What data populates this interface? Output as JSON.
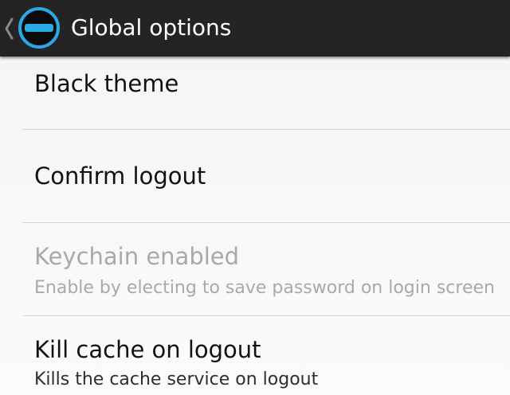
{
  "action_bar": {
    "title": "Global options",
    "up_icon": "chevron-left-icon",
    "app_icon": "minus-circle-icon",
    "icon_ring_color": "#2ba9e6",
    "icon_bar_color": "#2ba9e6",
    "background_color": "#242424"
  },
  "preferences": [
    {
      "title": "Black theme",
      "summary": "",
      "enabled": true
    },
    {
      "title": "Confirm logout",
      "summary": "",
      "enabled": true
    },
    {
      "title": "Keychain enabled",
      "summary": "Enable by electing to save password on login screen",
      "enabled": false
    },
    {
      "title": "Kill cache on logout",
      "summary": "Kills the cache service on logout",
      "enabled": true
    }
  ]
}
